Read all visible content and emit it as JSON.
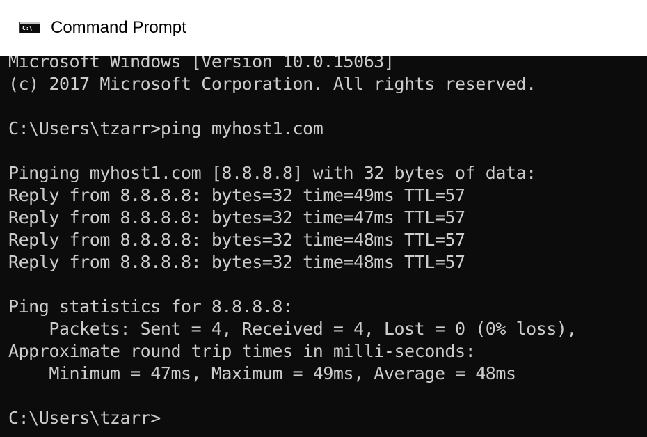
{
  "window": {
    "title": "Command Prompt",
    "icon_text": "C:\\",
    "icon_name": "command-prompt-icon",
    "colors": {
      "console_background": "#0c0c0c",
      "console_text": "#cccccc",
      "titlebar_background": "#ffffff"
    }
  },
  "console": {
    "lines": [
      "Microsoft Windows [Version 10.0.15063]",
      "(c) 2017 Microsoft Corporation. All rights reserved.",
      "",
      "C:\\Users\\tzarr>ping myhost1.com",
      "",
      "Pinging myhost1.com [8.8.8.8] with 32 bytes of data:",
      "Reply from 8.8.8.8: bytes=32 time=49ms TTL=57",
      "Reply from 8.8.8.8: bytes=32 time=47ms TTL=57",
      "Reply from 8.8.8.8: bytes=32 time=48ms TTL=57",
      "Reply from 8.8.8.8: bytes=32 time=48ms TTL=57",
      "",
      "Ping statistics for 8.8.8.8:",
      "    Packets: Sent = 4, Received = 4, Lost = 0 (0% loss),",
      "Approximate round trip times in milli-seconds:",
      "    Minimum = 47ms, Maximum = 49ms, Average = 48ms",
      "",
      "C:\\Users\\tzarr>"
    ]
  }
}
